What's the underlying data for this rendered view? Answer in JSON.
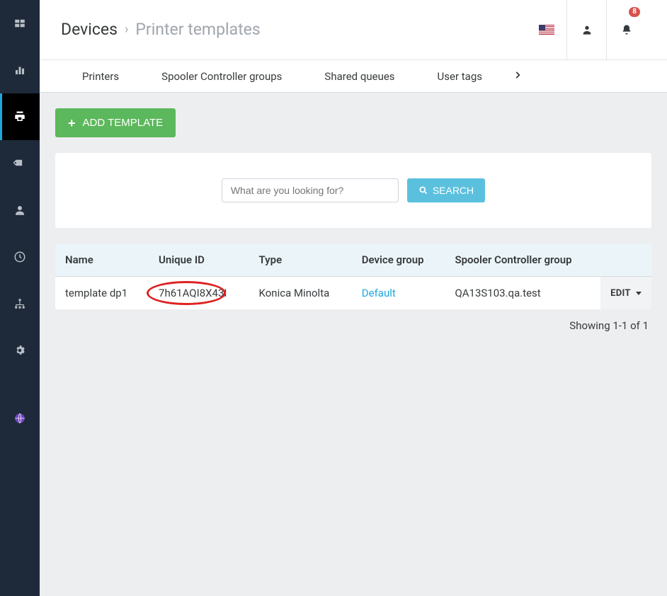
{
  "breadcrumb": {
    "parent": "Devices",
    "current": "Printer templates"
  },
  "notifications": {
    "count": "8"
  },
  "tabs": [
    {
      "label": "Printers"
    },
    {
      "label": "Spooler Controller groups"
    },
    {
      "label": "Shared queues"
    },
    {
      "label": "User tags"
    }
  ],
  "buttons": {
    "add_template": "ADD TEMPLATE",
    "search": "SEARCH",
    "edit": "EDIT"
  },
  "search": {
    "placeholder": "What are you looking for?"
  },
  "table": {
    "headers": {
      "name": "Name",
      "unique_id": "Unique ID",
      "type": "Type",
      "device_group": "Device group",
      "spooler_group": "Spooler Controller group"
    },
    "rows": [
      {
        "name": "template dp1",
        "unique_id": "7h61AQI8X43I",
        "type": "Konica Minolta",
        "device_group": "Default",
        "spooler_group": "QA13S103.qa.test"
      }
    ]
  },
  "pager": "Showing 1-1 of 1"
}
